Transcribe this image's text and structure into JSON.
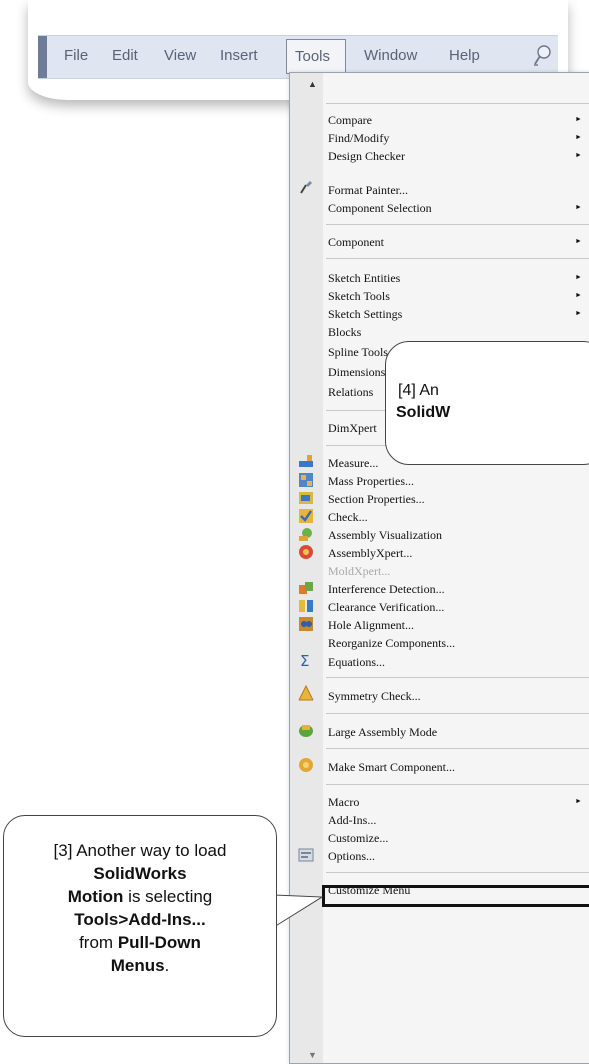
{
  "menubar": {
    "items": [
      "File",
      "Edit",
      "View",
      "Insert",
      "Tools",
      "Window",
      "Help"
    ],
    "pin_icon": "pin-icon"
  },
  "dropdown": {
    "scroll_up": "▲",
    "scroll_down": "▼",
    "items": {
      "compare": "Compare",
      "find_modify": "Find/Modify",
      "design_checker": "Design Checker",
      "format_painter": "Format Painter...",
      "component_selection": "Component Selection",
      "component": "Component",
      "sketch_entities": "Sketch Entities",
      "sketch_tools": "Sketch Tools",
      "sketch_settings": "Sketch Settings",
      "blocks": "Blocks",
      "spline_tools": "Spline Tools",
      "dimensions": "Dimensions",
      "relations": "Relations",
      "dimxpert": "DimXpert",
      "measure": "Measure...",
      "mass_properties": "Mass Properties...",
      "section_properties": "Section Properties...",
      "check": "Check...",
      "assembly_visualization": "Assembly Visualization",
      "assemblyxpert": "AssemblyXpert...",
      "molexpert": "MoldXpert...",
      "interference_detection": "Interference Detection...",
      "clearance_verification": "Clearance Verification...",
      "hole_alignment": "Hole Alignment...",
      "reorganize_components": "Reorganize Components...",
      "equations": "Equations...",
      "symmetry_check": "Symmetry Check...",
      "large_assembly_mode": "Large Assembly Mode",
      "make_smart_component": "Make Smart Component...",
      "macro": "Macro",
      "add_ins": "Add-Ins...",
      "customize": "Customize...",
      "options": "Options...",
      "customize_menu": "Customize Menu"
    },
    "submenu_arrow": "►"
  },
  "callout_4": {
    "line1": "[4] An",
    "line2": "SolidW"
  },
  "callout_3": {
    "p1": "[3] Another way to load",
    "b1": "SolidWorks",
    "b2": "Motion",
    "p2": " is selecting",
    "b3": "Tools>Add-Ins...",
    "p3": "from ",
    "b4": "Pull-Down",
    "b5": "Menus",
    "p4": "."
  },
  "colors": {
    "menubar_bg": "#dfe6f1",
    "menu_text": "#5a6374",
    "dropdown_bg": "#f5f5f5"
  }
}
